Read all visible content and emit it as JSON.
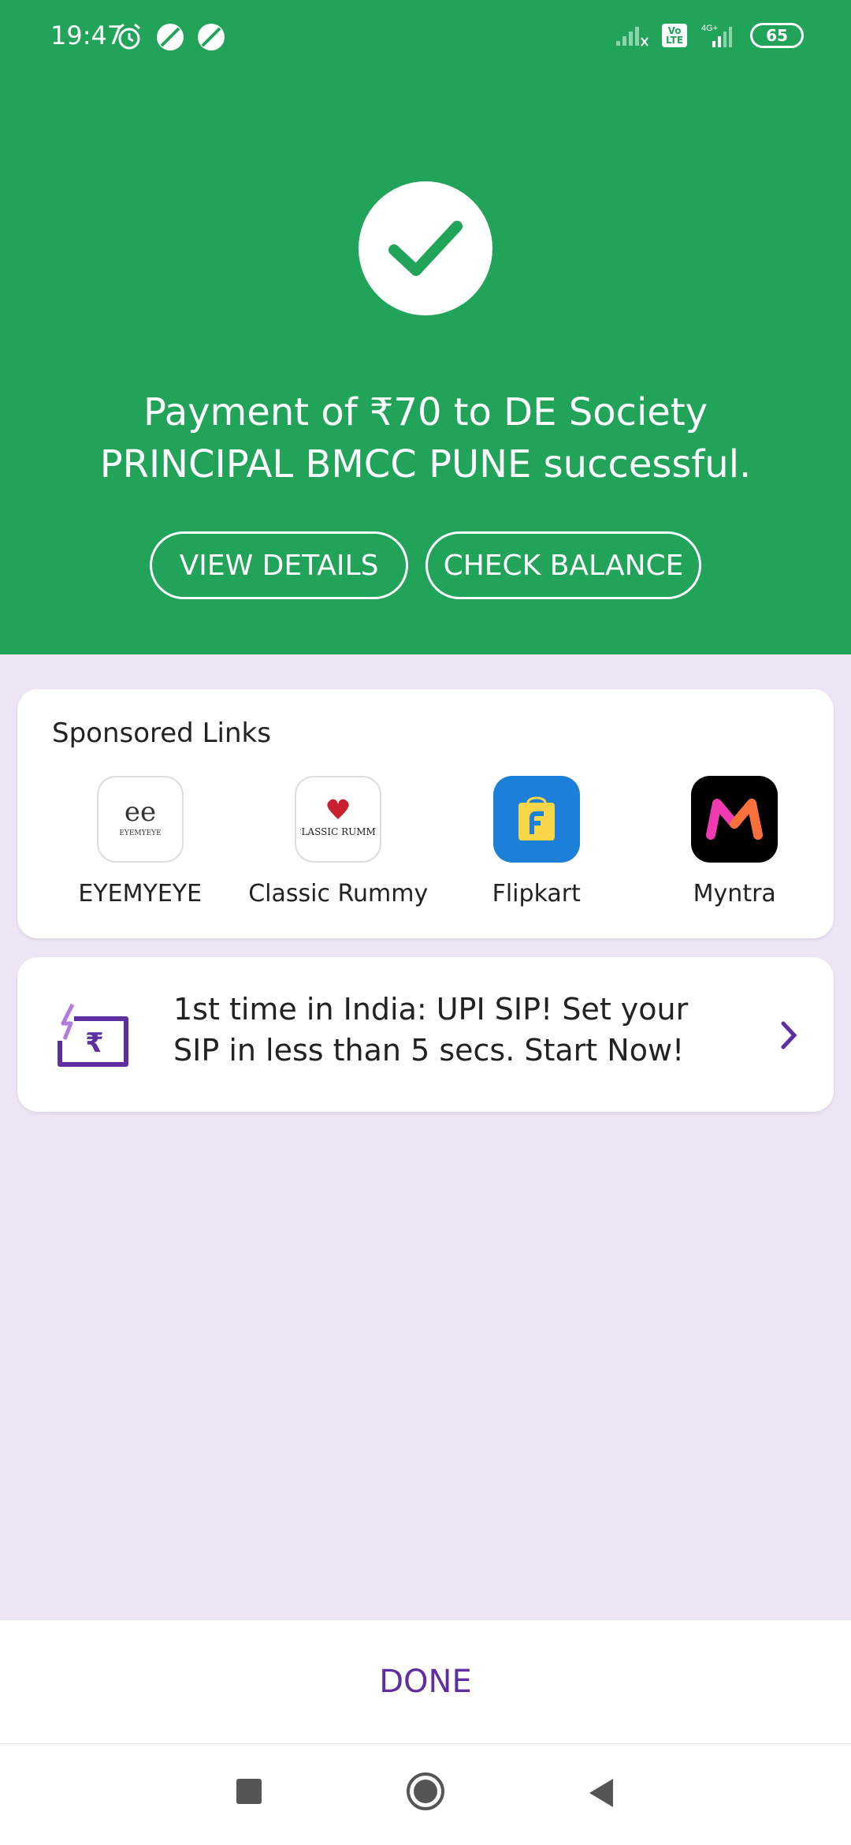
{
  "status_bar": {
    "time": "19:47",
    "battery": "65",
    "network": "4G+",
    "volte": "Vo LTE",
    "icons": [
      "alarm-icon",
      "app-icon",
      "app-icon",
      "signal-icon",
      "volte-icon",
      "signal-4g-icon",
      "battery-icon"
    ]
  },
  "hero": {
    "message": "Payment of ₹70 to DE Society PRINCIPAL BMCC PUNE successful.",
    "view_details": "VIEW DETAILS",
    "check_balance": "CHECK BALANCE",
    "accent": "#22A35A"
  },
  "sponsored": {
    "title": "Sponsored Links",
    "items": [
      {
        "name": "EYEMYEYE",
        "logo_text": "EYEMYEYE"
      },
      {
        "name": "Classic Rummy",
        "logo_text": "CLASSIC RUMMY"
      },
      {
        "name": "Flipkart"
      },
      {
        "name": "Myntra"
      }
    ]
  },
  "promo": {
    "text": "1st time in India: UPI SIP! Set your SIP in less than 5 secs. Start Now!"
  },
  "footer": {
    "done_label": "DONE",
    "done_color": "#5F2EA0"
  }
}
